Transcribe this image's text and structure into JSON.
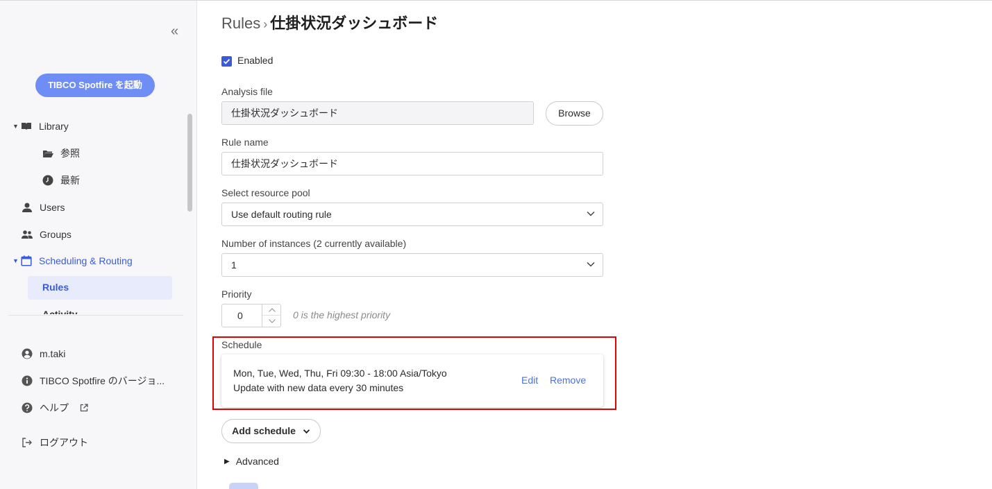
{
  "sidebar": {
    "launch_label": "TIBCO Spotfire を起動",
    "library": {
      "label": "Library",
      "children": [
        {
          "label": "参照"
        },
        {
          "label": "最新"
        }
      ]
    },
    "users_label": "Users",
    "groups_label": "Groups",
    "scheduling_label": "Scheduling & Routing",
    "rules_label": "Rules",
    "activity_label": "Activity",
    "user_label": "m.taki",
    "version_label": "TIBCO Spotfire のバージョ...",
    "help_label": "ヘルプ",
    "logout_label": "ログアウト"
  },
  "breadcrumb": {
    "root": "Rules",
    "separator": "›",
    "current": "仕掛状況ダッシュボード"
  },
  "form": {
    "enabled_label": "Enabled",
    "enabled": true,
    "analysis_file_label": "Analysis file",
    "analysis_file_value": "仕掛状況ダッシュボード",
    "browse_label": "Browse",
    "rule_name_label": "Rule name",
    "rule_name_value": "仕掛状況ダッシュボード",
    "resource_pool_label": "Select resource pool",
    "resource_pool_value": "Use default routing rule",
    "instances_label": "Number of instances (2 currently available)",
    "instances_value": "1",
    "priority_label": "Priority",
    "priority_value": "0",
    "priority_hint": "0 is the highest priority",
    "schedule_label": "Schedule",
    "schedule": {
      "line1": "Mon, Tue, Wed, Thu, Fri 09:30 - 18:00 Asia/Tokyo",
      "line2": "Update with new data every 30 minutes",
      "edit_label": "Edit",
      "remove_label": "Remove"
    },
    "add_schedule_label": "Add schedule",
    "advanced_label": "Advanced"
  },
  "colors": {
    "accent": "#3a5bd9",
    "launch_button": "#6f8ef5",
    "highlight_box": "#e00000"
  }
}
